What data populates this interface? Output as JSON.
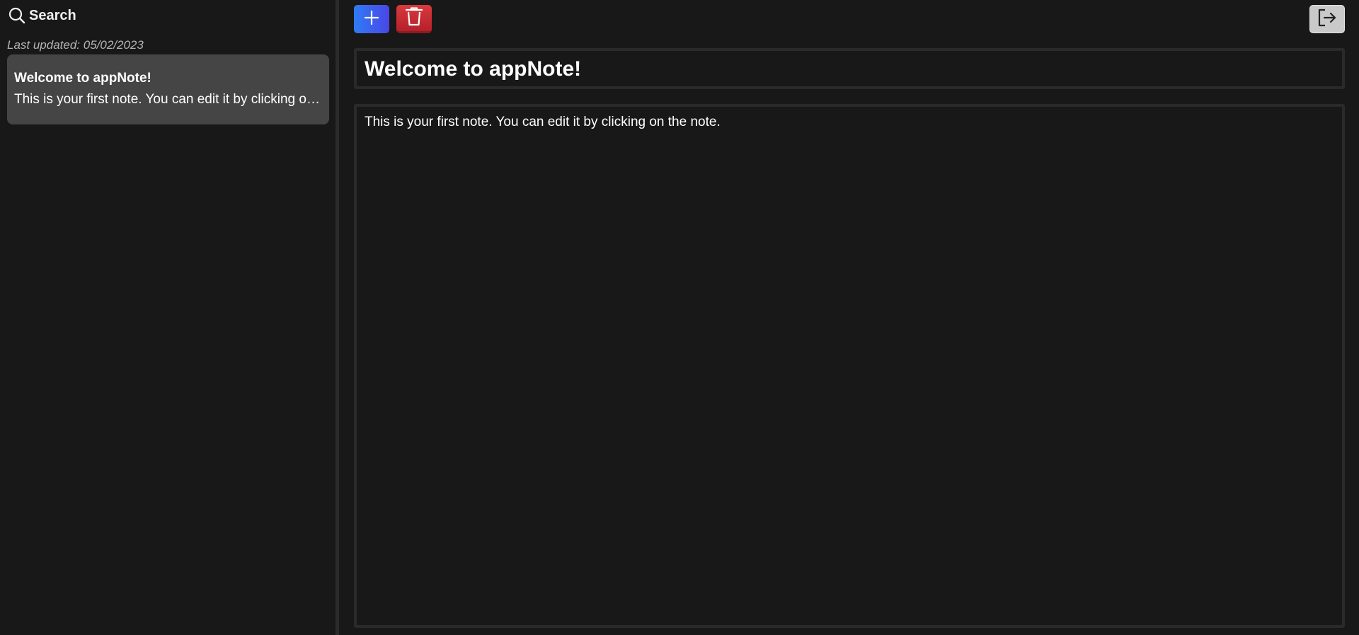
{
  "sidebar": {
    "search_label": "Search",
    "search_icon": "search-icon",
    "last_updated": "Last updated: 05/02/2023",
    "notes": [
      {
        "title": "Welcome to appNote!",
        "preview": "This is your first note. You can edit it by clicking on the note."
      }
    ]
  },
  "toolbar": {
    "add_icon": "plus-icon",
    "delete_icon": "trash-icon",
    "logout_icon": "logout-icon"
  },
  "editor": {
    "title": "Welcome to appNote!",
    "body": "This is your first note. You can edit it by clicking on the note."
  },
  "colors": {
    "background": "#181818",
    "card": "#454545",
    "add_button": "#2f7cf6",
    "delete_button": "#d93a3e",
    "logout_button": "#c9c9c9",
    "border": "#2a2a2a"
  }
}
